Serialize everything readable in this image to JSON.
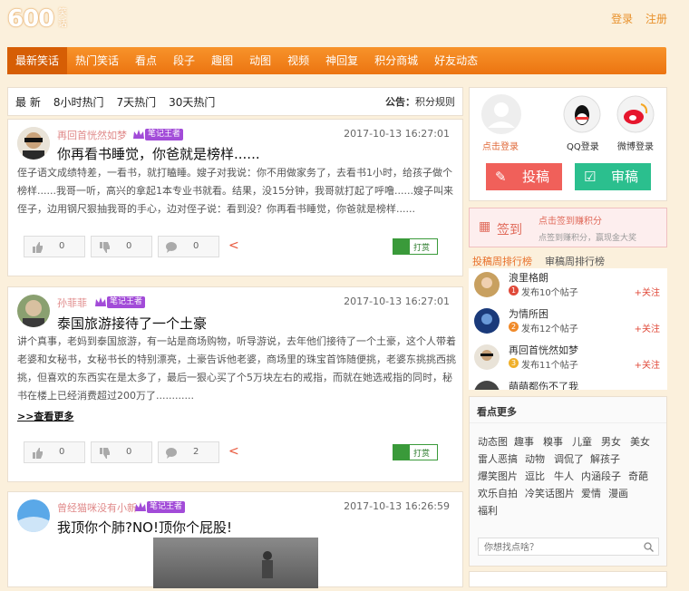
{
  "logo": {
    "main": "600",
    "sub": "笑话"
  },
  "toplinks": {
    "login": "登录",
    "register": "注册"
  },
  "nav": [
    "最新笑话",
    "热门笑话",
    "看点",
    "段子",
    "趣图",
    "动图",
    "视频",
    "神回复",
    "积分商城",
    "好友动态"
  ],
  "tabs": {
    "items": [
      "最 新",
      "8小时热门",
      "7天热门",
      "30天热门"
    ],
    "notice_label": "公告：",
    "notice_text": "积分规则"
  },
  "badge_text": "笔记王者",
  "posts": [
    {
      "user": "再回首恍然如梦",
      "time": "2017-10-13 16:27:01",
      "title": "你再看书睡觉，你爸就是榜样......",
      "body": "侄子语文成绩特差，一看书，就打瞌睡。嫂子对我说：你不用做家务了，去看书1小时，给孩子做个榜样......我哥一听，高兴的拿起1本专业书就看。结果，没15分钟，我哥就打起了呼噜......嫂子叫来侄子，边用钢尺狠抽我哥的手心，边对侄子说：看到没？你再看书睡觉，你爸就是榜样......",
      "likes": "0",
      "dislikes": "0",
      "comments": "0",
      "reward": "打赏"
    },
    {
      "user": "孙菲菲",
      "time": "2017-10-13 16:27:01",
      "title": "泰国旅游接待了一个土豪",
      "body": "讲个真事，老妈到泰国旅游，有一站是商场购物，听导游说，去年他们接待了一个土豪，这个人带着老婆和女秘书，女秘书长的特别漂亮，土豪告诉他老婆，商场里的珠宝首饰随便挑，老婆东挑挑西挑挑，但喜欢的东西实在是太多了，最后一狠心买了个5万块左右的戒指，而就在她选戒指的同时，秘书在楼上已经消费超过200万了............",
      "more": ">>查看更多",
      "likes": "0",
      "dislikes": "0",
      "comments": "2",
      "reward": "打赏"
    },
    {
      "user": "曾经猫咪没有小新",
      "time": "2017-10-13 16:26:59",
      "title": "我顶你个肺?NO!顶你个屁股!"
    }
  ],
  "sidebar": {
    "login_link": "点击登录",
    "qq_login": "QQ登录",
    "weibo_login": "微博登录",
    "post_btn": "投稿",
    "review_btn": "审稿",
    "signin": "签到",
    "signin_hint1": "点击签到赚积分",
    "signin_hint2": "点签到赚积分，赢现金大奖",
    "rank_tabs": [
      "投稿周排行榜",
      "审稿周排行榜"
    ],
    "ranks": [
      {
        "name": "浪里格朗",
        "posts": "发布10个帖子",
        "num": "1"
      },
      {
        "name": "为情所困",
        "posts": "发布12个帖子",
        "num": "2"
      },
      {
        "name": "再回首恍然如梦",
        "posts": "发布11个帖子",
        "num": "3"
      },
      {
        "name": "萌萌都伤不了我",
        "posts": "",
        "num": ""
      }
    ],
    "follow": "+关注",
    "kandian_title": "看点更多",
    "kandian_tags": [
      "动态图",
      "趣事",
      "糗事",
      "儿童",
      "男女",
      "美女",
      "雷人恶搞",
      "动物",
      "调侃了",
      "解孩子",
      "爆笑图片",
      "逗比",
      "牛人",
      "内涵段子",
      "奇葩",
      "欢乐自拍",
      "冷笑话图片",
      "爱情",
      "漫画",
      "福利"
    ],
    "search_placeholder": "你想找点啥？"
  },
  "colors": {
    "orange": "#f28a20",
    "nav_active": "#d65e05",
    "post_red": "#f0605a",
    "review_green": "#2bbf8e",
    "badge_purple": "#a24bd8"
  }
}
